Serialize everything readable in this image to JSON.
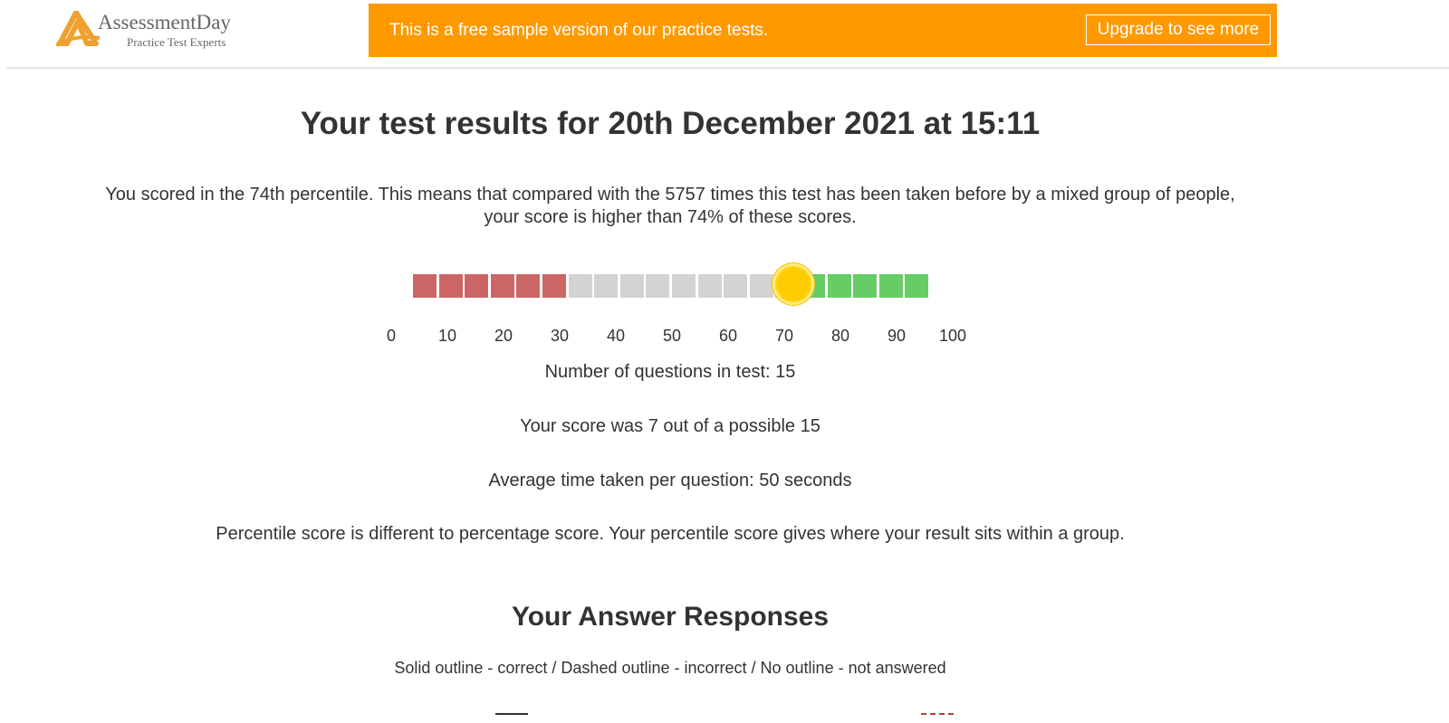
{
  "logo": {
    "name": "AssessmentDay",
    "tagline": "Practice Test Experts"
  },
  "banner": {
    "message": "This is a free sample version of our practice tests.",
    "button_label": "Upgrade to see more",
    "color": "#ff9900"
  },
  "results": {
    "title": "Your test results for 20th December 2021 at 15:11",
    "summary": "You scored in the 74th percentile. This means that compared with the 5757 times this test has been taken before by a mixed group of people, your score is higher than 74% of these scores.",
    "percentile": 74,
    "scale": {
      "ticks": [
        "0",
        "10",
        "20",
        "30",
        "40",
        "50",
        "60",
        "70",
        "80",
        "90",
        "100"
      ],
      "colors": {
        "low": "#cc6666",
        "mid": "#d3d3d3",
        "high": "#66cc66",
        "marker": "#ffcc00"
      }
    },
    "questions_line": "Number of questions in test: 15",
    "score_line": "Your score was 7 out of a possible 15",
    "time_line": "Average time taken per question: 50 seconds",
    "note_line": "Percentile score is different to percentage score. Your percentile score gives where your result sits within a group."
  },
  "responses": {
    "heading": "Your Answer Responses",
    "legend": "Solid outline - correct / Dashed outline - incorrect / No outline - not answered"
  }
}
